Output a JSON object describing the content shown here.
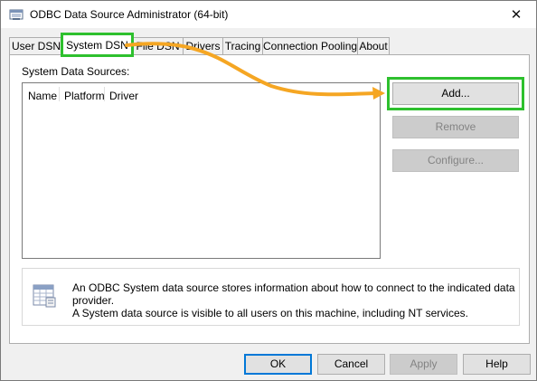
{
  "window": {
    "title": "ODBC Data Source Administrator (64-bit)"
  },
  "titlebar": {
    "icon": "odbc-admin-icon",
    "close_glyph": "✕"
  },
  "tabs": [
    {
      "label": "User DSN"
    },
    {
      "label": "System DSN",
      "active": true
    },
    {
      "label": "File DSN"
    },
    {
      "label": "Drivers"
    },
    {
      "label": "Tracing"
    },
    {
      "label": "Connection Pooling"
    },
    {
      "label": "About"
    }
  ],
  "system_dsn": {
    "section_label": "System Data Sources:",
    "columns": [
      "Name",
      "Platform",
      "Driver"
    ],
    "rows": [],
    "buttons": {
      "add": {
        "label": "Add...",
        "enabled": true
      },
      "remove": {
        "label": "Remove",
        "enabled": false
      },
      "configure": {
        "label": "Configure...",
        "enabled": false
      }
    },
    "info": {
      "icon": "database-table-icon",
      "line1": "An ODBC System data source stores information about how to connect to the indicated data provider.",
      "line2": "A System data source is visible to all users on this machine, including NT services."
    }
  },
  "footer": {
    "ok": "OK",
    "cancel": "Cancel",
    "apply": "Apply",
    "help": "Help"
  },
  "annotation": {
    "highlight_color": "#2ec02e",
    "arrow_color": "#f5a623"
  }
}
